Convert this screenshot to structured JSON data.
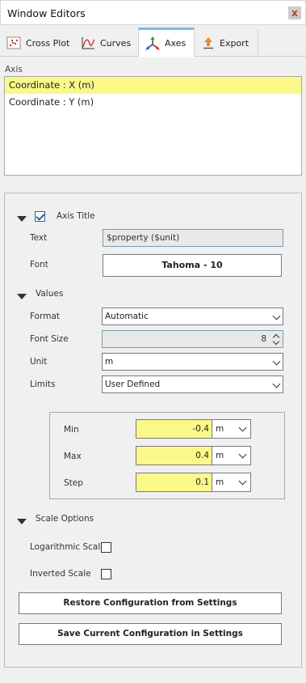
{
  "window": {
    "title": "Window Editors",
    "close_label": "x"
  },
  "tabs": [
    {
      "label": "Cross Plot",
      "icon": "scatter-icon",
      "active": false
    },
    {
      "label": "Curves",
      "icon": "curve-icon",
      "active": false
    },
    {
      "label": "Axes",
      "icon": "axes-icon",
      "active": true
    },
    {
      "label": "Export",
      "icon": "export-icon",
      "active": false
    }
  ],
  "axis": {
    "section_label": "Axis",
    "items": [
      {
        "label": "Coordinate : X (m)",
        "selected": true
      },
      {
        "label": "Coordinate : Y (m)",
        "selected": false
      }
    ]
  },
  "axis_title": {
    "label": "Axis Title",
    "checked": true,
    "text_label": "Text",
    "text_value": "$property ($unit)",
    "font_label": "Font",
    "font_value": "Tahoma - 10"
  },
  "values": {
    "label": "Values",
    "format_label": "Format",
    "format_value": "Automatic",
    "font_size_label": "Font Size",
    "font_size_value": "8",
    "unit_label": "Unit",
    "unit_value": "m",
    "limits_label": "Limits",
    "limits_value": "User Defined"
  },
  "limits": {
    "min_label": "Min",
    "min_value": "-0.4",
    "min_unit": "m",
    "max_label": "Max",
    "max_value": "0.4",
    "max_unit": "m",
    "step_label": "Step",
    "step_value": "0.1",
    "step_unit": "m"
  },
  "scale_options": {
    "label": "Scale Options",
    "logarithmic_label": "Logarithmic Scale",
    "logarithmic_checked": false,
    "inverted_label": "Inverted Scale",
    "inverted_checked": false
  },
  "buttons": {
    "restore": "Restore Configuration from Settings",
    "save": "Save Current Configuration in Settings"
  },
  "colors": {
    "highlight": "#fbf88a",
    "tab_accent": "#7eb6ea"
  }
}
